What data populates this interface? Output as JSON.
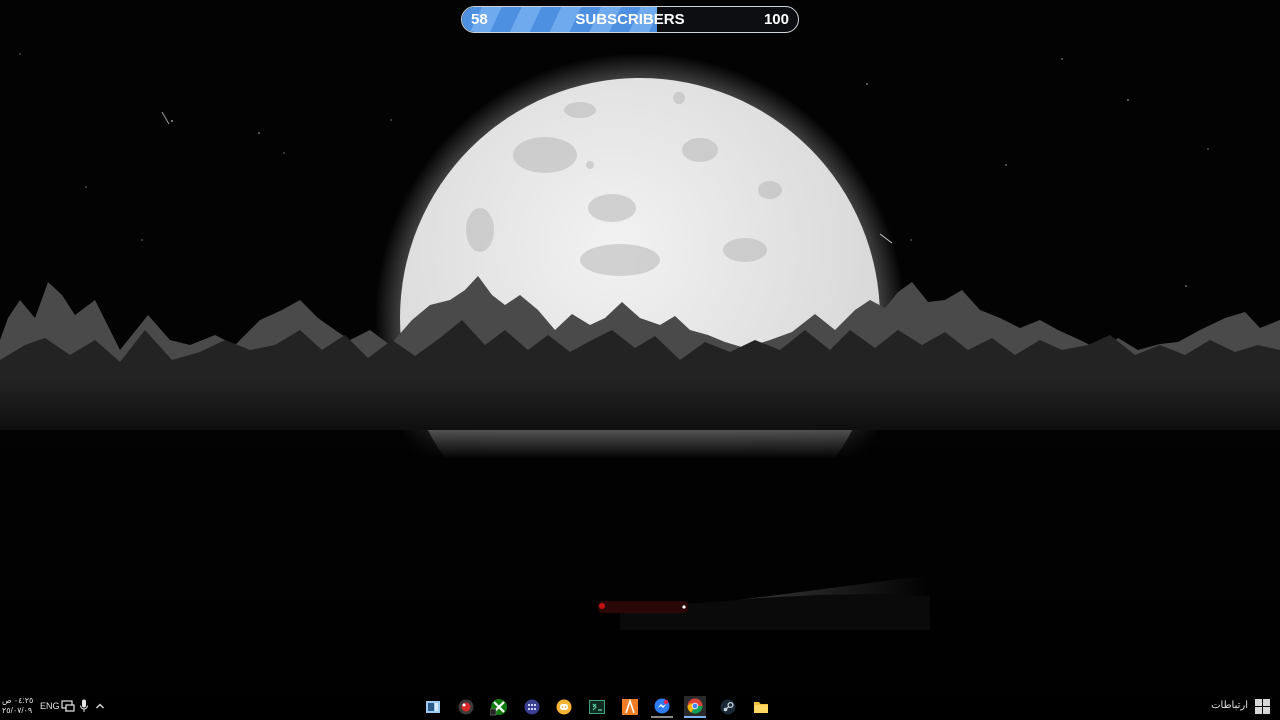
{
  "subscriber_widget": {
    "current": "58",
    "label": "SUBSCRIBERS",
    "goal": "100",
    "progress_fraction": 0.58
  },
  "taskbar": {
    "start_icon": "windows-logo-icon",
    "connections_label": "ارتباطات",
    "pinned_apps": [
      {
        "name": "explorer",
        "icon": "folder-icon",
        "state": "none"
      },
      {
        "name": "steam",
        "icon": "steam-icon",
        "state": "none"
      },
      {
        "name": "chrome",
        "icon": "chrome-icon",
        "state": "active"
      },
      {
        "name": "messenger",
        "icon": "messenger-icon",
        "state": "running"
      },
      {
        "name": "app-orange",
        "icon": "orange-a-icon",
        "state": "none"
      },
      {
        "name": "terminal",
        "icon": "terminal-icon",
        "state": "none"
      },
      {
        "name": "discord",
        "icon": "discord-icon",
        "state": "none"
      },
      {
        "name": "app-grid",
        "icon": "grid-app-icon",
        "state": "none"
      },
      {
        "name": "xbox",
        "icon": "xbox-icon",
        "state": "none"
      },
      {
        "name": "app-red",
        "icon": "red-app-icon",
        "state": "none"
      },
      {
        "name": "task-view",
        "icon": "task-view-icon",
        "state": "none"
      }
    ],
    "tray": {
      "chevron_icon": "chevron-up-icon",
      "mic_icon": "microphone-icon",
      "network_icon": "network-icon",
      "language": "ENG",
      "time": "٠٤:٢٥ ص",
      "date": "٢٥/٠٧/٠٩"
    }
  },
  "colors": {
    "accent": "#5a9bea",
    "widget_border": "#cfd4da",
    "moon": "#e6e6e6"
  }
}
